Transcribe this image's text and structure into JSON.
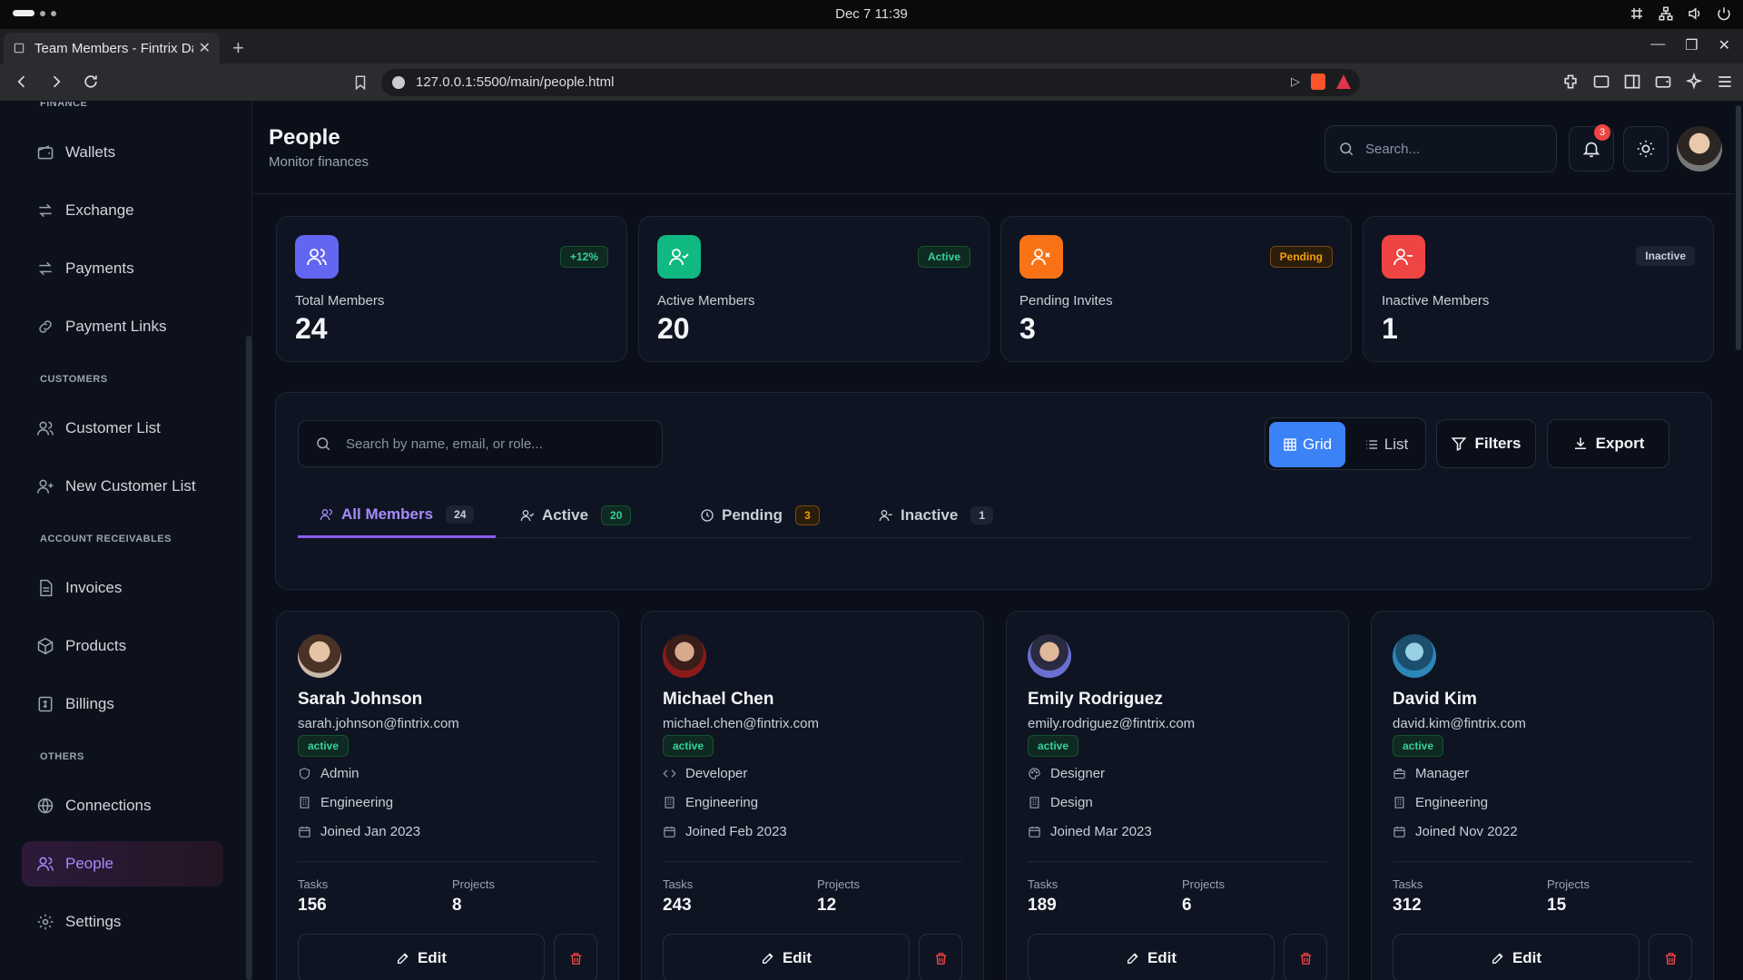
{
  "os": {
    "clock": "Dec 7  11:39"
  },
  "browser": {
    "tab_title": "Team Members - Fintrix Dashboard",
    "url": "127.0.0.1:5500/main/people.html"
  },
  "sidebar": {
    "sections": [
      {
        "title": "FINANCE"
      },
      {
        "title": "CUSTOMERS"
      },
      {
        "title": "ACCOUNT RECEIVABLES"
      },
      {
        "title": "OTHERS"
      }
    ],
    "items": [
      {
        "label": "Wallets",
        "icon": "wallet-icon"
      },
      {
        "label": "Exchange",
        "icon": "exchange-icon"
      },
      {
        "label": "Payments",
        "icon": "payments-icon"
      },
      {
        "label": "Payment Links",
        "icon": "link-icon"
      },
      {
        "label": "Customer List",
        "icon": "users-icon"
      },
      {
        "label": "New Customer List",
        "icon": "user-plus-icon"
      },
      {
        "label": "Invoices",
        "icon": "invoice-icon"
      },
      {
        "label": "Products",
        "icon": "box-icon"
      },
      {
        "label": "Billings",
        "icon": "billing-icon"
      },
      {
        "label": "Connections",
        "icon": "globe-icon"
      },
      {
        "label": "People",
        "icon": "people-icon",
        "active": true
      },
      {
        "label": "Settings",
        "icon": "gear-icon"
      }
    ]
  },
  "header": {
    "title": "People",
    "subtitle": "Monitor finances",
    "search_placeholder": "Search...",
    "notification_count": "3"
  },
  "stats": [
    {
      "label": "Total Members",
      "value": "24",
      "badge": "+12%",
      "color": "#6366f1"
    },
    {
      "label": "Active Members",
      "value": "20",
      "badge": "Active",
      "color": "#10b981"
    },
    {
      "label": "Pending Invites",
      "value": "3",
      "badge": "Pending",
      "color": "#f97316"
    },
    {
      "label": "Inactive Members",
      "value": "1",
      "badge": "Inactive",
      "color": "#ef4444"
    }
  ],
  "toolbar": {
    "search_placeholder": "Search by name, email, or role...",
    "grid_label": "Grid",
    "list_label": "List",
    "filters_label": "Filters",
    "export_label": "Export"
  },
  "filter_tabs": [
    {
      "label": "All Members",
      "count": "24",
      "active": true
    },
    {
      "label": "Active",
      "count": "20"
    },
    {
      "label": "Pending",
      "count": "3"
    },
    {
      "label": "Inactive",
      "count": "1"
    }
  ],
  "members": [
    {
      "name": "Sarah Johnson",
      "email": "sarah.johnson@fintrix.com",
      "status": "active",
      "role": "Admin",
      "role_icon": "shield-icon",
      "department": "Engineering",
      "joined": "Joined Jan 2023",
      "tasks": "156",
      "projects": "8"
    },
    {
      "name": "Michael Chen",
      "email": "michael.chen@fintrix.com",
      "status": "active",
      "role": "Developer",
      "role_icon": "code-icon",
      "department": "Engineering",
      "joined": "Joined Feb 2023",
      "tasks": "243",
      "projects": "12"
    },
    {
      "name": "Emily Rodriguez",
      "email": "emily.rodriguez@fintrix.com",
      "status": "active",
      "role": "Designer",
      "role_icon": "palette-icon",
      "department": "Design",
      "joined": "Joined Mar 2023",
      "tasks": "189",
      "projects": "6"
    },
    {
      "name": "David Kim",
      "email": "david.kim@fintrix.com",
      "status": "active",
      "role": "Manager",
      "role_icon": "briefcase-icon",
      "department": "Engineering",
      "joined": "Joined Nov 2022",
      "tasks": "312",
      "projects": "15"
    }
  ],
  "card_labels": {
    "tasks": "Tasks",
    "projects": "Projects",
    "edit": "Edit"
  }
}
